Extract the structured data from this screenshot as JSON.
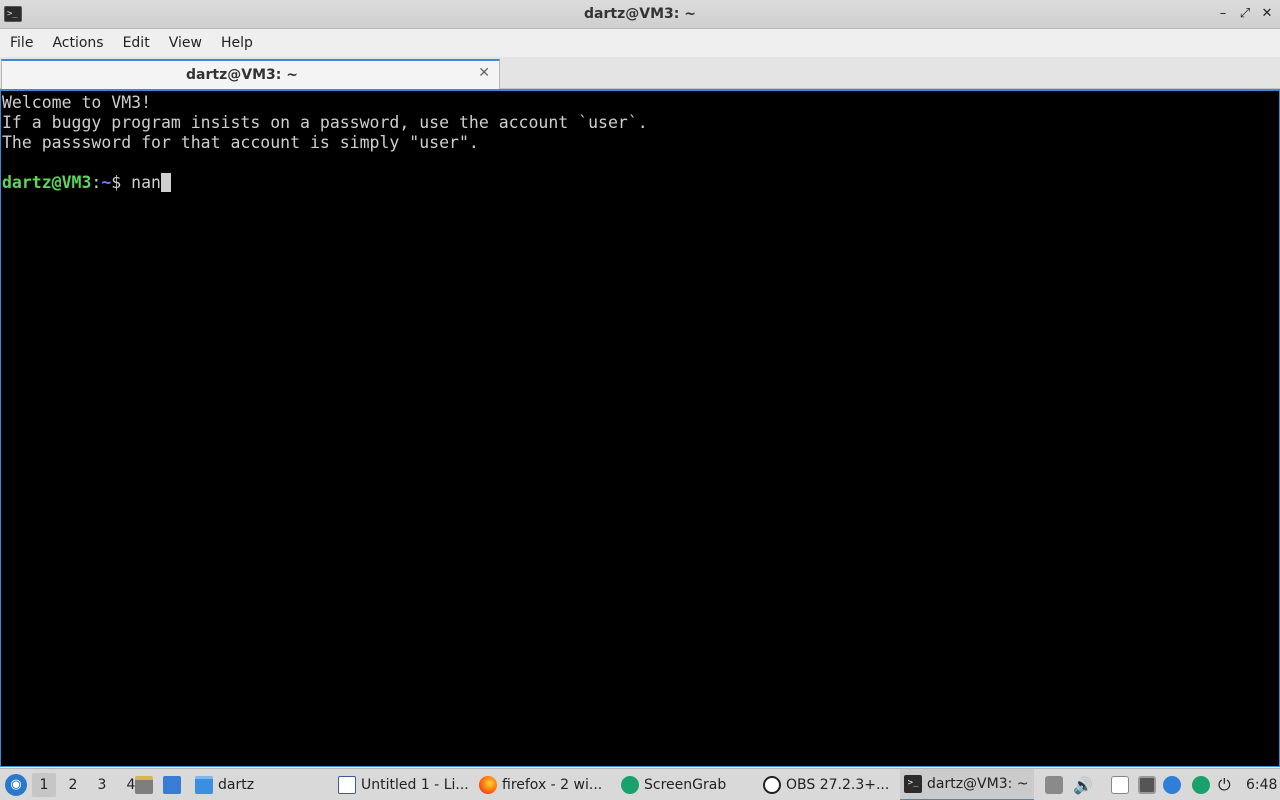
{
  "window": {
    "title": "dartz@VM3: ~",
    "app_icon": "terminal-icon",
    "buttons": {
      "minimize": "–",
      "restore": "⤢",
      "close": "✕"
    }
  },
  "menu": [
    "File",
    "Actions",
    "Edit",
    "View",
    "Help"
  ],
  "tab": {
    "label": "dartz@VM3: ~",
    "close": "✕"
  },
  "terminal": {
    "lines": [
      "Welcome to VM3!",
      "If a buggy program insists on a password, use the account `user`.",
      "The passsword for that account is simply \"user\".",
      ""
    ],
    "prompt": {
      "user": "dartz@VM3",
      "sep": ":",
      "path": "~",
      "symbol": "$ ",
      "input": "nan"
    }
  },
  "taskbar": {
    "workspaces": [
      "1",
      "2",
      "3",
      "4"
    ],
    "active_workspace": "1",
    "launchers": {
      "folder_label": "dartz"
    },
    "tasks": [
      {
        "label": "Untitled 1 - Li...",
        "icon": "document-icon"
      },
      {
        "label": "firefox - 2 wi...",
        "icon": "firefox-icon"
      },
      {
        "label": "ScreenGrab",
        "icon": "screengrab-icon"
      },
      {
        "label": "OBS 27.2.3+...",
        "icon": "obs-icon"
      },
      {
        "label": "dartz@VM3: ~",
        "icon": "terminal-icon"
      }
    ],
    "clock": "6:48"
  }
}
